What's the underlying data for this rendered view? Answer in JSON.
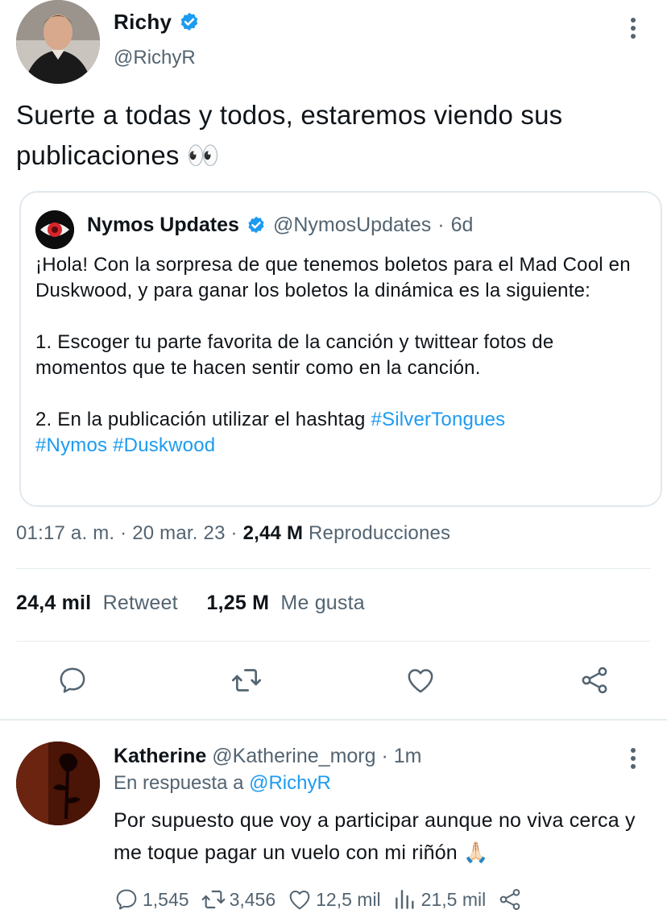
{
  "tweet": {
    "author_name": "Richy",
    "author_handle": "@RichyR",
    "text": "Suerte a todas y todos, estaremos viendo sus publicaciones 👀",
    "timestamp_time": "01:17 a. m.",
    "timestamp_date": "20 mar. 23",
    "views_count": "2,44 M",
    "views_label": "Reproducciones",
    "retweets_count": "24,4 mil",
    "retweets_label": "Retweet",
    "likes_count": "1,25 M",
    "likes_label": "Me gusta"
  },
  "quote": {
    "author_name": "Nymos Updates",
    "author_handle": "@NymosUpdates",
    "age": "6d",
    "para1": "¡Hola! Con la sorpresa de que tenemos boletos para el Mad Cool en Duskwood, y para ganar los boletos la dinámica es la siguiente:",
    "para2": "1. Escoger tu parte favorita de la canción y twittear fotos de momentos que te hacen sentir como en la canción.",
    "para3_text": "2. En la publicación utilizar el hashtag ",
    "hashtag1": "#SilverTongues",
    "hashtag2": "#Nymos",
    "hashtag3": "#Duskwood"
  },
  "reply": {
    "author_name": "Katherine",
    "author_handle": "@Katherine_morg",
    "age": "1m",
    "in_reply_prefix": "En respuesta a",
    "in_reply_mention": "@RichyR",
    "text": "Por supuesto que voy a participar aunque no viva cerca y me toque pagar un vuelo con mi riñón 🙏🏻",
    "replies": "1,545",
    "retweets": "3,456",
    "likes": "12,5 mil",
    "views": "21,5 mil"
  },
  "colors": {
    "link": "#1d9bf0",
    "secondary_text": "#536471",
    "primary_text": "#0f1419",
    "verified_badge": "#1d9bf0",
    "divider": "#e6ecf0"
  },
  "icons": [
    "verified-icon",
    "more-icon",
    "reply-icon",
    "retweet-icon",
    "like-icon",
    "share-icon",
    "views-icon"
  ]
}
